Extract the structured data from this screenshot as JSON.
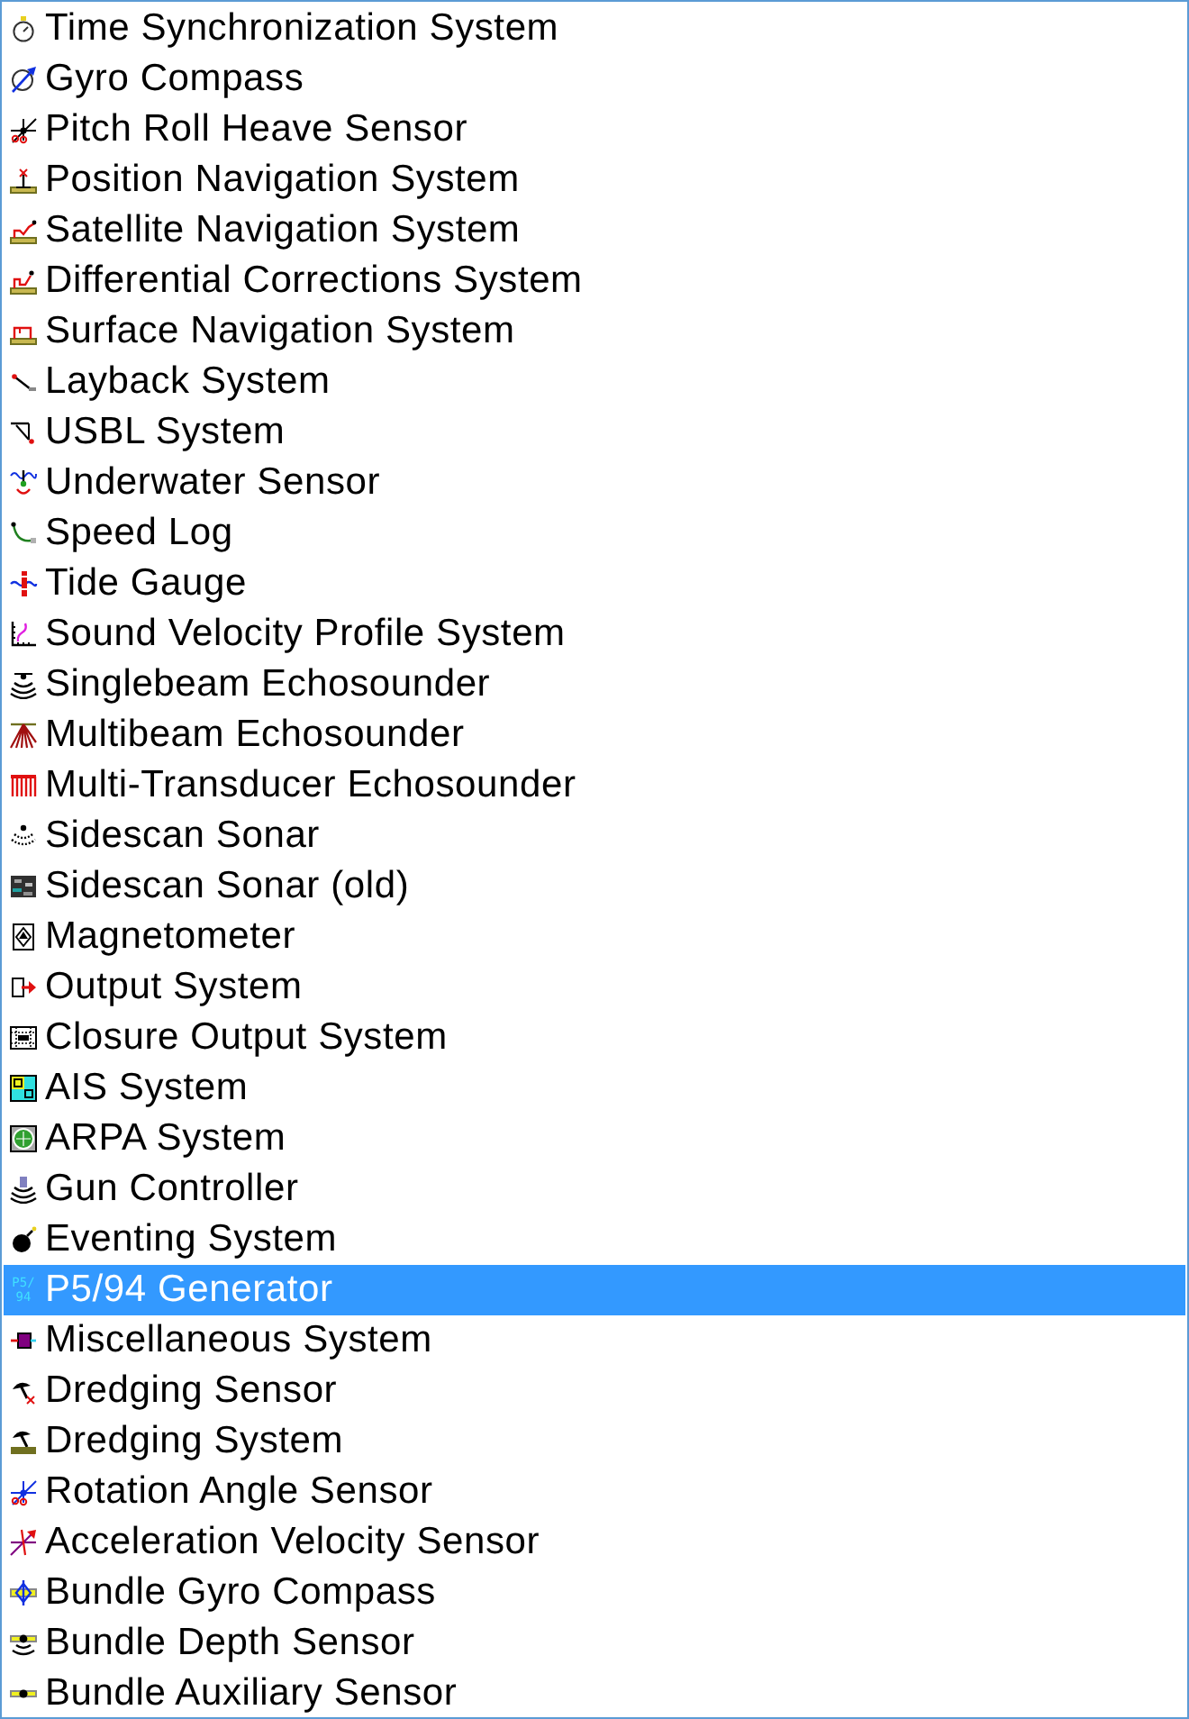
{
  "list": {
    "items": [
      {
        "label": "Time Synchronization System",
        "selected": false
      },
      {
        "label": "Gyro Compass",
        "selected": false
      },
      {
        "label": "Pitch Roll Heave Sensor",
        "selected": false
      },
      {
        "label": "Position Navigation System",
        "selected": false
      },
      {
        "label": "Satellite Navigation System",
        "selected": false
      },
      {
        "label": "Differential Corrections System",
        "selected": false
      },
      {
        "label": "Surface Navigation System",
        "selected": false
      },
      {
        "label": "Layback System",
        "selected": false
      },
      {
        "label": "USBL System",
        "selected": false
      },
      {
        "label": "Underwater Sensor",
        "selected": false
      },
      {
        "label": "Speed Log",
        "selected": false
      },
      {
        "label": "Tide Gauge",
        "selected": false
      },
      {
        "label": "Sound Velocity Profile System",
        "selected": false
      },
      {
        "label": "Singlebeam Echosounder",
        "selected": false
      },
      {
        "label": "Multibeam Echosounder",
        "selected": false
      },
      {
        "label": "Multi-Transducer Echosounder",
        "selected": false
      },
      {
        "label": "Sidescan Sonar",
        "selected": false
      },
      {
        "label": "Sidescan Sonar (old)",
        "selected": false
      },
      {
        "label": "Magnetometer",
        "selected": false
      },
      {
        "label": "Output System",
        "selected": false
      },
      {
        "label": "Closure Output System",
        "selected": false
      },
      {
        "label": "AIS System",
        "selected": false
      },
      {
        "label": "ARPA System",
        "selected": false
      },
      {
        "label": "Gun Controller",
        "selected": false
      },
      {
        "label": "Eventing System",
        "selected": false
      },
      {
        "label": "P5/94 Generator",
        "selected": true,
        "icon_text": "P5/\n94"
      },
      {
        "label": "Miscellaneous System",
        "selected": false
      },
      {
        "label": "Dredging Sensor",
        "selected": false
      },
      {
        "label": "Dredging System",
        "selected": false
      },
      {
        "label": "Rotation Angle Sensor",
        "selected": false
      },
      {
        "label": "Acceleration Velocity Sensor",
        "selected": false
      },
      {
        "label": "Bundle Gyro Compass",
        "selected": false
      },
      {
        "label": "Bundle Depth Sensor",
        "selected": false
      },
      {
        "label": "Bundle Auxiliary Sensor",
        "selected": false
      }
    ]
  }
}
